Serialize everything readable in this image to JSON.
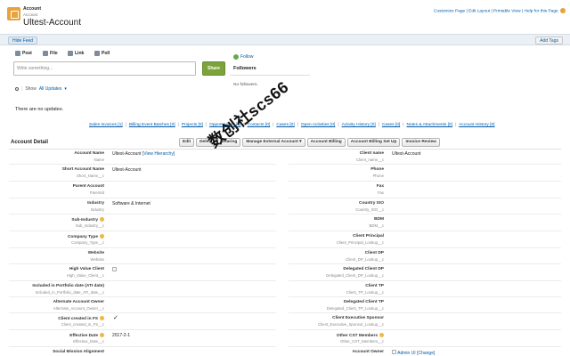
{
  "header": {
    "object_type": "Account",
    "object_sub": "Account",
    "account_name": "Ultest-Account",
    "top_links": "Customize Page | Edit Layout | Printable View | Help for this Page"
  },
  "feedbar": {
    "hide_feed": "Hide Feed",
    "add_tags": "Add Tags"
  },
  "publisher": {
    "tabs": [
      "Post",
      "File",
      "Link",
      "Poll"
    ],
    "input_placeholder": "Write something...",
    "share": "Share"
  },
  "followers": {
    "follow": "Follow",
    "title": "Followers",
    "empty": "No followers."
  },
  "feed": {
    "show_label": "Show",
    "show_filter": "All Updates",
    "empty": "There are no updates."
  },
  "related_links": [
    "Sales Invoices [1]",
    "Billing Event Batches [0]",
    "Projects [0]",
    "Opportunities [2]",
    "Contacts [0]",
    "Cases [0]",
    "Open Activities [0]",
    "Activity History [0]",
    "Cases [0]",
    "Notes & Attachments [0]",
    "Account History [0]"
  ],
  "detail": {
    "title": "Account Detail",
    "buttons": [
      "Edit",
      "Delete",
      "Sharing",
      "Manage External Account",
      "Account Billing",
      "Account Billing Set Up",
      "Invoice Review"
    ],
    "left_fields": [
      {
        "label": "Account Name",
        "api": "Name",
        "value": "Ultest-Account",
        "link": "[View Hierarchy]"
      },
      {
        "label": "Short Account Name",
        "api": "Short_Name__c",
        "value": "Ultest-Account"
      },
      {
        "label": "Parent Account",
        "api": "ParentId",
        "value": ""
      },
      {
        "label": "Industry",
        "api": "Industry",
        "value": "Software & Internet"
      },
      {
        "label": "Sub-Industry",
        "api": "Sub_Industry__c",
        "value": ""
      },
      {
        "label": "Company Type",
        "api": "Company_Type__c",
        "value": ""
      },
      {
        "label": "Website",
        "api": "Website",
        "value": ""
      },
      {
        "label": "High Value Client",
        "api": "High_Value_Client__c",
        "value": ""
      },
      {
        "label": "Included in Portfolio date (ATI date)",
        "api": "Included_in_Portfolio_date_ATI_date__c",
        "value": ""
      },
      {
        "label": "Alternate Account Owner",
        "api": "Alternate_Account_Owner__c",
        "value": ""
      },
      {
        "label": "Client created in FS",
        "api": "Client_created_in_FS__c",
        "value": "✓"
      },
      {
        "label": "Effective Date",
        "api": "Effective_Date__c",
        "value": "2017-2-1"
      },
      {
        "label": "Social Mission Alignment",
        "api": "",
        "value": ""
      }
    ],
    "right_fields": [
      {
        "label": "Client name",
        "api": "Client_name__c",
        "value": "Ultest-Account"
      },
      {
        "label": "Phone",
        "api": "Phone",
        "value": ""
      },
      {
        "label": "Fax",
        "api": "Fax",
        "value": ""
      },
      {
        "label": "Country ISO",
        "api": "Country_ISO__c",
        "value": ""
      },
      {
        "label": "BDM",
        "api": "BDM__c",
        "value": ""
      },
      {
        "label": "Client Principal",
        "api": "Client_Principal_Lookup__c",
        "value": ""
      },
      {
        "label": "Client DP",
        "api": "Client_DP_Lookup__c",
        "value": ""
      },
      {
        "label": "Delegated Client DP",
        "api": "Delegated_Client_DP_Lookup__c",
        "value": ""
      },
      {
        "label": "Client TP",
        "api": "Client_TP_Lookup__c",
        "value": ""
      },
      {
        "label": "Delegated Client TP",
        "api": "Delegated_Client_TP_Lookup__c",
        "value": ""
      },
      {
        "label": "Client Executive Sponsor",
        "api": "Client_Executive_Sponsor_Lookup__c",
        "value": ""
      },
      {
        "label": "Other CST Members",
        "api": "Other_CST_Members__c",
        "value": ""
      },
      {
        "label": "Account Owner",
        "api": "",
        "value": "Admin UI [Change]"
      }
    ]
  },
  "watermark": "数创社scs66"
}
